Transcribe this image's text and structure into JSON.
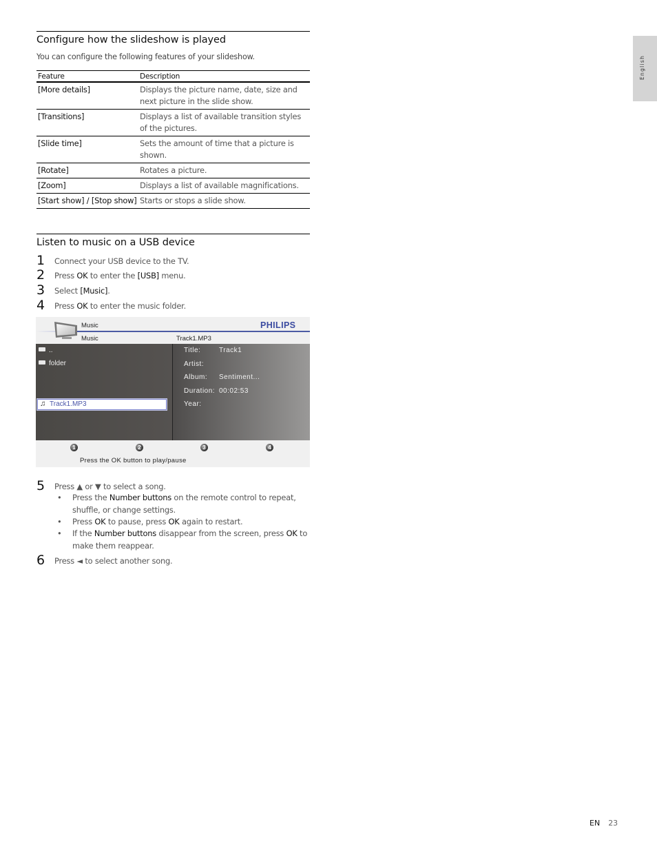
{
  "side_tab": {
    "label": "English"
  },
  "section1": {
    "title": "Configure how the slideshow is played",
    "intro": "You can configure the following features of your slideshow.",
    "table": {
      "headers": [
        "Feature",
        "Description"
      ],
      "rows": [
        {
          "feature": "[More details]",
          "description": "Displays the picture name, date, size and next picture in the slide show."
        },
        {
          "feature": "[Transitions]",
          "description": "Displays a list of available transition styles of the pictures."
        },
        {
          "feature": "[Slide time]",
          "description": "Sets the amount of time that a picture is shown."
        },
        {
          "feature": "[Rotate]",
          "description": "Rotates a picture."
        },
        {
          "feature": "[Zoom]",
          "description": "Displays a list of available magnifications."
        },
        {
          "feature": "[Start show] / [Stop show]",
          "description": "Starts or stops a slide show."
        }
      ]
    }
  },
  "section2": {
    "title": "Listen to music on a USB device",
    "steps": [
      {
        "num": "1",
        "parts": [
          {
            "t": "Connect your USB device to the TV."
          }
        ]
      },
      {
        "num": "2",
        "parts": [
          {
            "t": "Press "
          },
          {
            "t": "OK",
            "b": true
          },
          {
            "t": " to enter the "
          },
          {
            "t": "[USB]",
            "b": true
          },
          {
            "t": " menu."
          }
        ]
      },
      {
        "num": "3",
        "parts": [
          {
            "t": "Select "
          },
          {
            "t": "[Music]",
            "b": true
          },
          {
            "t": "."
          }
        ]
      },
      {
        "num": "4",
        "parts": [
          {
            "t": "Press "
          },
          {
            "t": "OK",
            "b": true
          },
          {
            "t": " to enter the music folder."
          }
        ]
      },
      {
        "num": "5",
        "parts": [
          {
            "t": "Press ▲ or ▼ to select a song."
          }
        ]
      },
      {
        "num": "6",
        "parts": [
          {
            "t": "Press ◄ to select another song."
          }
        ]
      }
    ],
    "bullets": [
      [
        {
          "t": "Press the "
        },
        {
          "t": "Number buttons",
          "b": true
        },
        {
          "t": " on the remote control to repeat, shuffle, or change settings."
        }
      ],
      [
        {
          "t": "Press "
        },
        {
          "t": "OK",
          "b": true
        },
        {
          "t": " to pause, press "
        },
        {
          "t": "OK",
          "b": true
        },
        {
          "t": " again to restart."
        }
      ],
      [
        {
          "t": "If the "
        },
        {
          "t": "Number buttons",
          "b": true
        },
        {
          "t": " disappear from the screen, press "
        },
        {
          "t": "OK",
          "b": true
        },
        {
          "t": " to make them reappear."
        }
      ]
    ]
  },
  "tv_screen": {
    "breadcrumb_top": "Music",
    "breadcrumb_sub": "Music",
    "current_file": "Track1.MP3",
    "brand": "PHILIPS",
    "file_list": [
      {
        "name": "..",
        "icon": "folder-icon"
      },
      {
        "name": "folder",
        "icon": "folder-icon"
      },
      {
        "name": "Track1.MP3",
        "icon": "music-note-icon",
        "selected": true
      }
    ],
    "info": [
      {
        "label": "Title:",
        "value": "Track1"
      },
      {
        "label": "Artist:",
        "value": ""
      },
      {
        "label": "Album:",
        "value": "Sentiment..."
      },
      {
        "label": "Duration:",
        "value": "00:02:53"
      },
      {
        "label": "Year:",
        "value": ""
      }
    ],
    "number_buttons": [
      "1",
      "2",
      "3",
      "4"
    ],
    "hint": "Press the OK button to play/pause"
  },
  "footer": {
    "lang": "EN",
    "page": "23"
  }
}
